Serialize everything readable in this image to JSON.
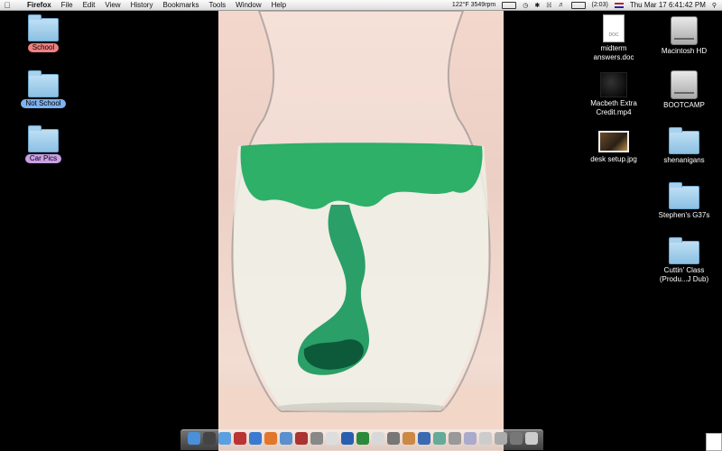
{
  "menubar": {
    "apple_icon": "apple-icon",
    "app_name": "Firefox",
    "menus": [
      "File",
      "Edit",
      "View",
      "History",
      "Bookmarks",
      "Tools",
      "Window",
      "Help"
    ],
    "status": {
      "temp_fan": "122°F 3549rpm",
      "battery_time": "(2:03)",
      "clock": "Thu Mar 17   6:41:42 PM"
    }
  },
  "desktop": {
    "left_icons": [
      {
        "label": "School",
        "label_color": "#f08080"
      },
      {
        "label": "Not School",
        "label_color": "#7fb2f0"
      },
      {
        "label": "Car Pics",
        "label_color": "#c9a0e6"
      }
    ],
    "right_col1": [
      {
        "label_line1": "midterm",
        "label_line2": "answers.doc",
        "icon": "doc-icon",
        "doc_text": "DOC"
      },
      {
        "label_line1": "Macbeth Extra",
        "label_line2": "Credit.mp4",
        "icon": "movie-icon"
      },
      {
        "label_line1": "desk setup.jpg",
        "label_line2": "",
        "icon": "photo-icon"
      }
    ],
    "right_col2": [
      {
        "label_line1": "Macintosh HD",
        "label_line2": "",
        "icon": "hard-drive-icon"
      },
      {
        "label_line1": "BOOTCAMP",
        "label_line2": "",
        "icon": "hard-drive-icon"
      },
      {
        "label_line1": "shenanigans",
        "label_line2": "",
        "icon": "folder-icon"
      },
      {
        "label_line1": "Stephen's G37s",
        "label_line2": "",
        "icon": "folder-icon"
      },
      {
        "label_line1": "Cuttin' Class",
        "label_line2": "(Produ...J Dub)",
        "icon": "folder-icon"
      }
    ]
  },
  "dock": {
    "icons": [
      {
        "name": "finder-icon",
        "color": "#4a8fd9"
      },
      {
        "name": "dashboard-icon",
        "color": "#444"
      },
      {
        "name": "ichat-icon",
        "color": "#5aa0e0"
      },
      {
        "name": "address-book-icon",
        "color": "#b33"
      },
      {
        "name": "safari-icon",
        "color": "#3a7ad0"
      },
      {
        "name": "firefox-icon",
        "color": "#e0772a"
      },
      {
        "name": "itunes-icon",
        "color": "#5a8fd0"
      },
      {
        "name": "photo-booth-icon",
        "color": "#a33"
      },
      {
        "name": "preview-icon",
        "color": "#888"
      },
      {
        "name": "ical-icon",
        "color": "#ddd"
      },
      {
        "name": "word-icon",
        "color": "#2a5fb0"
      },
      {
        "name": "excel-icon",
        "color": "#2a8a3a"
      },
      {
        "name": "pages-icon",
        "color": "#d8d8d8"
      },
      {
        "name": "starcraft-icon",
        "color": "#777"
      },
      {
        "name": "garageband-icon",
        "color": "#c84"
      },
      {
        "name": "quicktime-icon",
        "color": "#3a6ab0"
      },
      {
        "name": "iphoto-icon",
        "color": "#6a9"
      },
      {
        "name": "system-prefs-icon",
        "color": "#999"
      },
      {
        "name": "downloads-icon",
        "color": "#aac"
      },
      {
        "name": "documents-icon",
        "color": "#ccc"
      },
      {
        "name": "folder-stack-icon",
        "color": "#aaa"
      },
      {
        "name": "network-icon",
        "color": "#777"
      },
      {
        "name": "trash-icon",
        "color": "#ccc"
      }
    ]
  }
}
